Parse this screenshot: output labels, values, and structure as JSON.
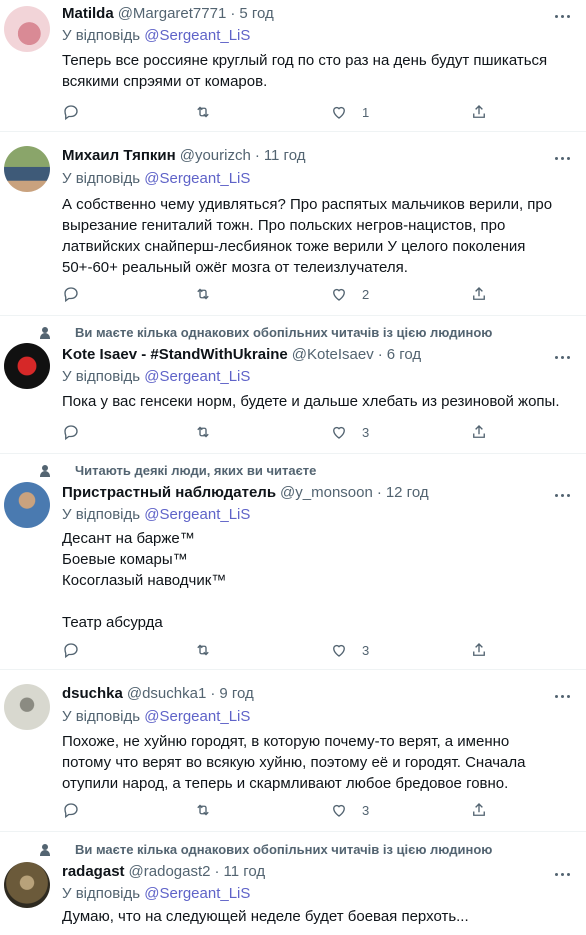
{
  "reply_prefix": "У відповідь",
  "tweets": [
    {
      "name": "Matilda",
      "handle": "@Margaret7771",
      "dot": "·",
      "time": "5 год",
      "reply_to": "@Sergeant_LiS",
      "text": "Теперь все россияне круглый год по сто раз на день будут пшикаться\nвсякими спрэями от комаров.",
      "likes": "1",
      "avatar_colors": [
        "#f2d4d8",
        "#d98a95"
      ]
    },
    {
      "name": "Михаил Тяпкин",
      "handle": "@yourizch",
      "dot": "·",
      "time": "11 год",
      "reply_to": "@Sergeant_LiS",
      "text": "А собственно чему удивляться? Про распятых мальчиков верили, про\nвырезание гениталий тожн. Про польских негров-нацистов, про\nлатвийских снайперш-лесбиянок тоже верили У целого поколения\n50+-60+ реальный ожёг мозга от телеизлучателя.",
      "likes": "2",
      "avatar_colors": [
        "#6d8a4c",
        "#3e5a78"
      ]
    },
    {
      "social": "Ви маєте кілька однакових обопільних читачів із цією людиною",
      "name": "Kote Isaev - #StandWithUkraine",
      "handle": "@KoteIsaev",
      "dot": "·",
      "time": "6 год",
      "reply_to": "@Sergeant_LiS",
      "text": "Пока у вас генсеки норм, будете и дальше хлебать из резиновой жопы.",
      "likes": "3",
      "avatar_colors": [
        "#1a1a1a",
        "#d62828"
      ]
    },
    {
      "social": "Читають деякі люди, яких ви читаєте",
      "name": "Пристрастный наблюдатель",
      "handle": "@y_monsoon",
      "dot": "·",
      "time": "12 год",
      "reply_to": "@Sergeant_LiS",
      "text": "Десант на барже™\nБоевые комары™\nКосоглазый наводчик™\n\nТеатр абсурда",
      "likes": "3",
      "avatar_colors": [
        "#4a7ab0",
        "#c9a27e"
      ]
    },
    {
      "name": "dsuchka",
      "handle": "@dsuchka1",
      "dot": "·",
      "time": "9 год",
      "reply_to": "@Sergeant_LiS",
      "text": "Похоже, не хуйню городят, в которую почему-то верят, а именно\nпотому что верят во всякую хуйню, поэтому её и городят. Сначала\nотупили народ, а теперь и скармливают любое бредовое говно.",
      "likes": "3",
      "avatar_colors": [
        "#d8d8cf",
        "#5a5a52"
      ]
    },
    {
      "social": "Ви маєте кілька однакових обопільних читачів із цією людиною",
      "name": "radagast",
      "handle": "@radogast2",
      "dot": "·",
      "time": "11 год",
      "reply_to": "@Sergeant_LiS",
      "text": "Думаю, что на следующей неделе будет боевая перхоть...",
      "avatar_colors": [
        "#6b5a3a",
        "#2e2a20"
      ]
    }
  ],
  "colors": {
    "text": "#0f1419",
    "secondary": "#536471",
    "mention": "#5f63c8",
    "divider": "#eff3f4"
  },
  "icons": [
    "reply-icon",
    "retweet-icon",
    "like-icon",
    "share-icon",
    "more-icon",
    "person-icon"
  ]
}
